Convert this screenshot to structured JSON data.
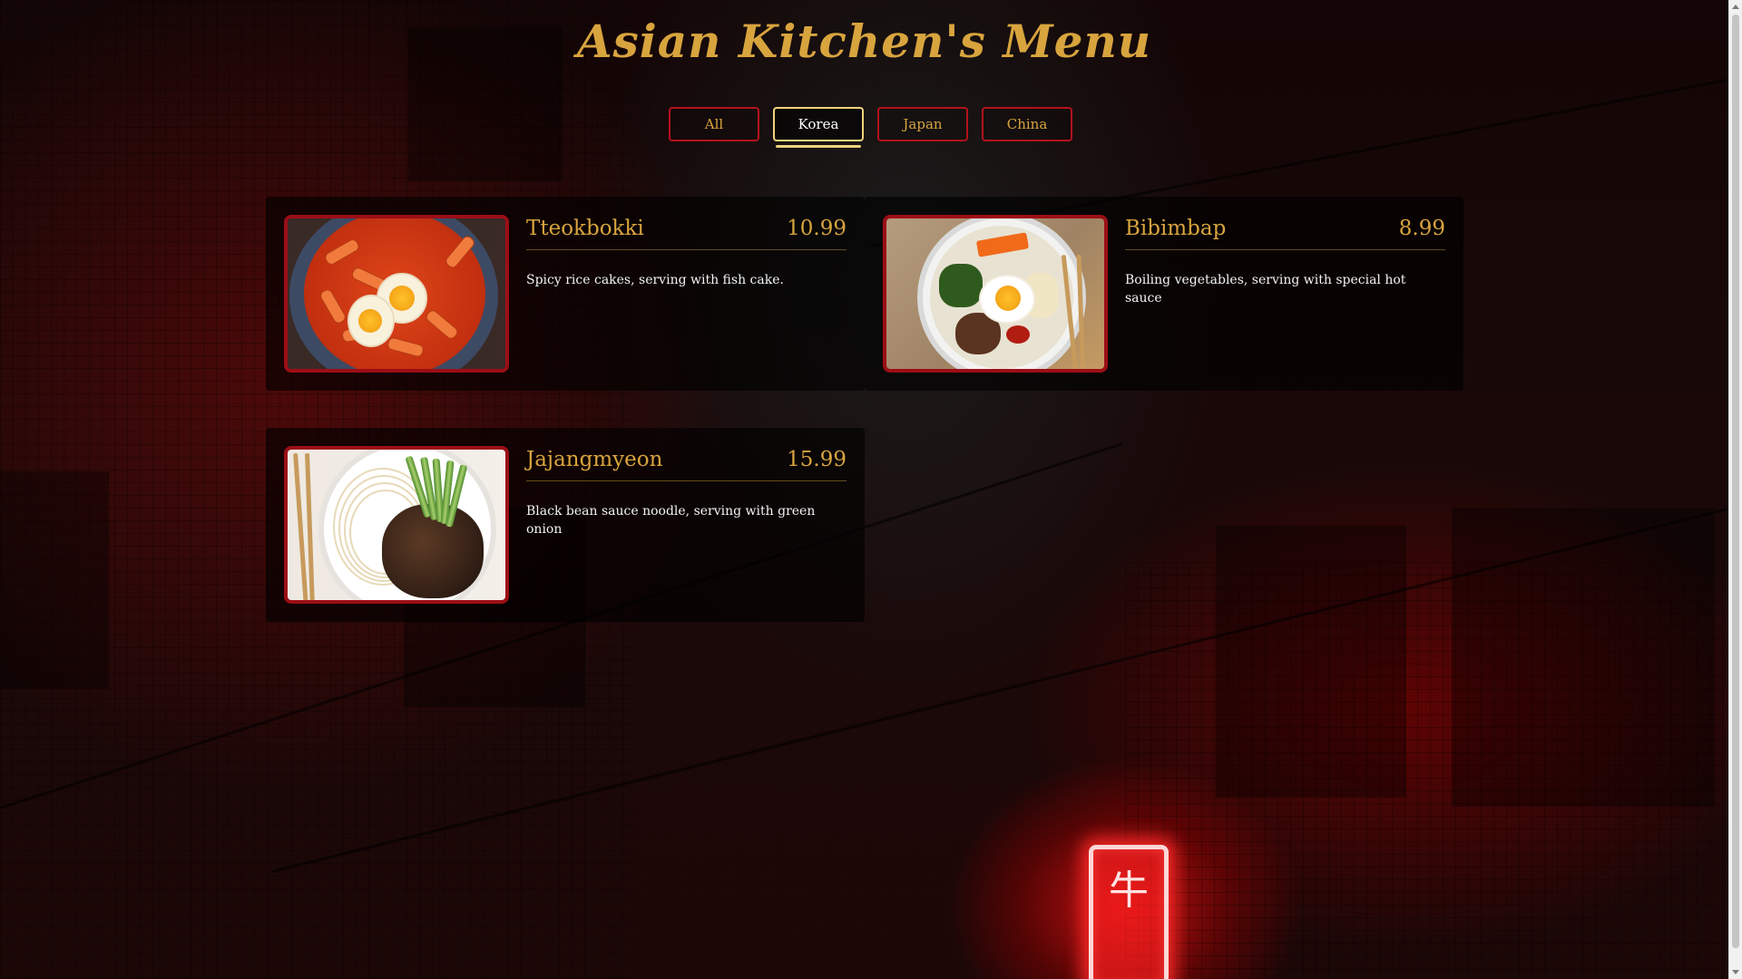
{
  "page": {
    "title": "Asian Kitchen's Menu"
  },
  "filters": {
    "active": "Korea",
    "buttons": [
      {
        "label": "All"
      },
      {
        "label": "Korea"
      },
      {
        "label": "Japan"
      },
      {
        "label": "China"
      }
    ]
  },
  "menu": {
    "items": [
      {
        "name": "Tteokbokki",
        "price": "10.99",
        "description": "Spicy rice cakes, serving with fish cake."
      },
      {
        "name": "Bibimbap",
        "price": "8.99",
        "description": "Boiling vegetables, serving with special hot sauce"
      },
      {
        "name": "Jajangmyeon",
        "price": "15.99",
        "description": "Black bean sauce noodle, serving with green onion"
      }
    ]
  },
  "colors": {
    "accent_gold": "#d8a43e",
    "card_border_red": "#9c0e16",
    "filter_border_red": "#b3121c",
    "active_filter": "#f2d37d"
  },
  "background": {
    "sign_glyph": "牛"
  }
}
